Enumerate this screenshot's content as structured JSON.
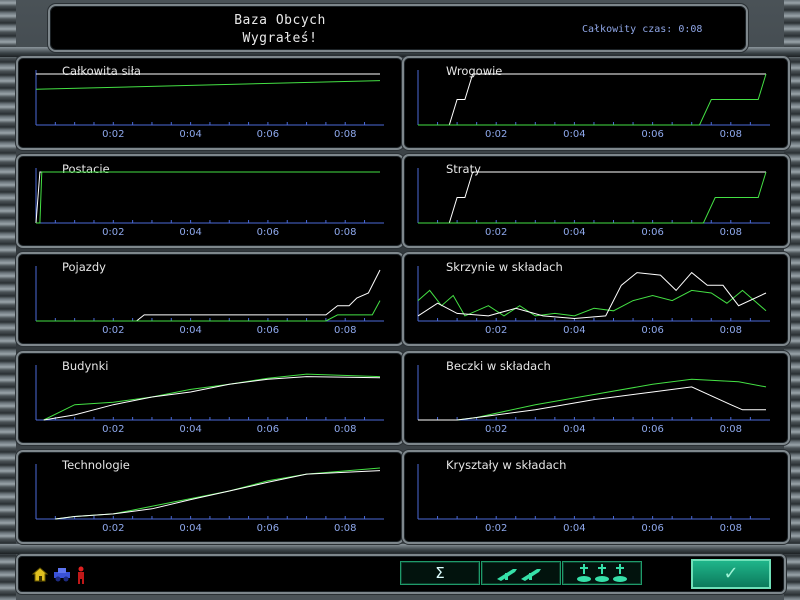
{
  "header": {
    "title_line1": "Baza Obcych",
    "title_line2": "Wygrałeś!",
    "timer_label": "Całkowity czas: 0:08"
  },
  "colors": {
    "green": "#44e044",
    "white": "#ffffff",
    "axis": "#4b6ad8",
    "tick_label": "#8ea8ec",
    "panel_border": "#7e878c",
    "accent_teal": "#1fb58a"
  },
  "x_tick_labels": [
    "0:02",
    "0:04",
    "0:06",
    "0:08"
  ],
  "charts": [
    {
      "title": "Całkowita siła",
      "chart_data": {
        "type": "line",
        "x": [
          0,
          8.9
        ],
        "ylim": [
          0,
          1
        ],
        "series": [
          {
            "color": "green",
            "points": [
              [
                0,
                0.7
              ],
              [
                8.9,
                0.87
              ]
            ]
          },
          {
            "color": "white",
            "points": [
              [
                0,
                1.0
              ],
              [
                8.9,
                1.0
              ]
            ]
          }
        ]
      }
    },
    {
      "title": "Wrogowie",
      "chart_data": {
        "type": "line",
        "x": [
          0,
          8.9
        ],
        "ylim": [
          0,
          1
        ],
        "series": [
          {
            "color": "white",
            "points": [
              [
                0,
                0
              ],
              [
                0.8,
                0
              ],
              [
                1.0,
                0.5
              ],
              [
                1.2,
                0.5
              ],
              [
                1.4,
                1
              ],
              [
                8.9,
                1
              ]
            ]
          },
          {
            "color": "green",
            "points": [
              [
                0,
                0
              ],
              [
                7.2,
                0
              ],
              [
                7.5,
                0.5
              ],
              [
                8.7,
                0.5
              ],
              [
                8.9,
                1
              ]
            ]
          }
        ]
      }
    },
    {
      "title": "Postacie",
      "chart_data": {
        "type": "line",
        "x": [
          0,
          8.9
        ],
        "ylim": [
          0,
          1
        ],
        "series": [
          {
            "color": "white",
            "points": [
              [
                0,
                0
              ],
              [
                0.1,
                1
              ],
              [
                8.9,
                1
              ]
            ]
          },
          {
            "color": "green",
            "points": [
              [
                0,
                0
              ],
              [
                0.1,
                0
              ],
              [
                0.15,
                1
              ],
              [
                8.9,
                1
              ]
            ]
          }
        ]
      }
    },
    {
      "title": "Straty",
      "chart_data": {
        "type": "line",
        "x": [
          0,
          8.9
        ],
        "ylim": [
          0,
          1
        ],
        "series": [
          {
            "color": "white",
            "points": [
              [
                0,
                0
              ],
              [
                0.8,
                0
              ],
              [
                1.0,
                0.5
              ],
              [
                1.2,
                0.5
              ],
              [
                1.4,
                1
              ],
              [
                8.9,
                1
              ]
            ]
          },
          {
            "color": "green",
            "points": [
              [
                0,
                0
              ],
              [
                7.3,
                0
              ],
              [
                7.6,
                0.5
              ],
              [
                8.7,
                0.5
              ],
              [
                8.9,
                1
              ]
            ]
          }
        ]
      }
    },
    {
      "title": "Pojazdy",
      "chart_data": {
        "type": "line",
        "x": [
          0,
          8.9
        ],
        "ylim": [
          0,
          1
        ],
        "series": [
          {
            "color": "white",
            "points": [
              [
                0,
                0
              ],
              [
                2.6,
                0
              ],
              [
                2.8,
                0.12
              ],
              [
                7.5,
                0.12
              ],
              [
                7.8,
                0.3
              ],
              [
                8.1,
                0.3
              ],
              [
                8.3,
                0.45
              ],
              [
                8.6,
                0.55
              ],
              [
                8.9,
                1
              ]
            ]
          },
          {
            "color": "green",
            "points": [
              [
                0,
                0
              ],
              [
                7.5,
                0
              ],
              [
                7.8,
                0.12
              ],
              [
                8.7,
                0.12
              ],
              [
                8.9,
                0.4
              ]
            ]
          }
        ]
      }
    },
    {
      "title": "Skrzynie w składach",
      "chart_data": {
        "type": "line",
        "x": [
          0,
          8.9
        ],
        "ylim": [
          0,
          1
        ],
        "series": [
          {
            "color": "green",
            "points": [
              [
                0,
                0.4
              ],
              [
                0.3,
                0.6
              ],
              [
                0.6,
                0.3
              ],
              [
                0.9,
                0.5
              ],
              [
                1.2,
                0.1
              ],
              [
                1.8,
                0.3
              ],
              [
                2.2,
                0.1
              ],
              [
                2.6,
                0.3
              ],
              [
                3.0,
                0.1
              ],
              [
                3.5,
                0.15
              ],
              [
                4.0,
                0.1
              ],
              [
                4.5,
                0.25
              ],
              [
                5.0,
                0.2
              ],
              [
                5.5,
                0.4
              ],
              [
                6.0,
                0.5
              ],
              [
                6.5,
                0.4
              ],
              [
                7.0,
                0.6
              ],
              [
                7.5,
                0.55
              ],
              [
                7.9,
                0.35
              ],
              [
                8.3,
                0.6
              ],
              [
                8.9,
                0.2
              ]
            ]
          },
          {
            "color": "white",
            "points": [
              [
                0,
                0.1
              ],
              [
                0.5,
                0.35
              ],
              [
                1.0,
                0.15
              ],
              [
                1.8,
                0.1
              ],
              [
                2.5,
                0.25
              ],
              [
                3.2,
                0.1
              ],
              [
                4.0,
                0.05
              ],
              [
                4.8,
                0.1
              ],
              [
                5.2,
                0.7
              ],
              [
                5.6,
                0.95
              ],
              [
                6.2,
                0.9
              ],
              [
                6.6,
                0.6
              ],
              [
                7.0,
                0.95
              ],
              [
                7.4,
                0.7
              ],
              [
                7.8,
                0.7
              ],
              [
                8.2,
                0.3
              ],
              [
                8.9,
                0.55
              ]
            ]
          }
        ]
      }
    },
    {
      "title": "Budynki",
      "chart_data": {
        "type": "line",
        "x": [
          0,
          8.9
        ],
        "ylim": [
          0,
          1
        ],
        "series": [
          {
            "color": "green",
            "points": [
              [
                0.2,
                0
              ],
              [
                1.0,
                0.3
              ],
              [
                2.0,
                0.35
              ],
              [
                3.0,
                0.45
              ],
              [
                4.0,
                0.6
              ],
              [
                5.0,
                0.7
              ],
              [
                6.0,
                0.82
              ],
              [
                7.0,
                0.9
              ],
              [
                8.9,
                0.85
              ]
            ]
          },
          {
            "color": "white",
            "points": [
              [
                0.2,
                0
              ],
              [
                1.0,
                0.1
              ],
              [
                2.0,
                0.3
              ],
              [
                3.0,
                0.45
              ],
              [
                4.0,
                0.55
              ],
              [
                5.0,
                0.7
              ],
              [
                6.0,
                0.8
              ],
              [
                7.0,
                0.85
              ],
              [
                8.9,
                0.83
              ]
            ]
          }
        ]
      }
    },
    {
      "title": "Beczki w składach",
      "chart_data": {
        "type": "line",
        "x": [
          0,
          8.9
        ],
        "ylim": [
          0,
          1
        ],
        "series": [
          {
            "color": "green",
            "points": [
              [
                0,
                0
              ],
              [
                1.0,
                0
              ],
              [
                1.5,
                0.05
              ],
              [
                3.0,
                0.3
              ],
              [
                4.5,
                0.5
              ],
              [
                6.0,
                0.7
              ],
              [
                7.0,
                0.8
              ],
              [
                8.2,
                0.75
              ],
              [
                8.9,
                0.65
              ]
            ]
          },
          {
            "color": "white",
            "points": [
              [
                0,
                0
              ],
              [
                1.0,
                0
              ],
              [
                1.5,
                0.05
              ],
              [
                3.0,
                0.2
              ],
              [
                4.5,
                0.4
              ],
              [
                6.0,
                0.55
              ],
              [
                7.0,
                0.65
              ],
              [
                8.0,
                0.3
              ],
              [
                8.3,
                0.2
              ],
              [
                8.9,
                0.2
              ]
            ]
          }
        ]
      }
    },
    {
      "title": "Technologie",
      "chart_data": {
        "type": "line",
        "x": [
          0,
          8.9
        ],
        "ylim": [
          0,
          1
        ],
        "series": [
          {
            "color": "green",
            "points": [
              [
                0.5,
                0
              ],
              [
                1.0,
                0.05
              ],
              [
                2.0,
                0.1
              ],
              [
                3.0,
                0.25
              ],
              [
                4.0,
                0.4
              ],
              [
                5.0,
                0.55
              ],
              [
                6.0,
                0.75
              ],
              [
                7.0,
                0.88
              ],
              [
                8.9,
                1
              ]
            ]
          },
          {
            "color": "white",
            "points": [
              [
                0.5,
                0
              ],
              [
                1.0,
                0.05
              ],
              [
                2.0,
                0.1
              ],
              [
                3.0,
                0.2
              ],
              [
                4.0,
                0.38
              ],
              [
                5.0,
                0.55
              ],
              [
                6.0,
                0.72
              ],
              [
                7.0,
                0.88
              ],
              [
                8.9,
                0.95
              ]
            ]
          }
        ]
      }
    },
    {
      "title": "Kryształy w składach",
      "chart_data": {
        "type": "line",
        "x": [
          0,
          8.9
        ],
        "ylim": [
          0,
          1
        ],
        "series": []
      }
    }
  ],
  "bottom": {
    "status_icons": [
      "house-icon",
      "vehicle-icon",
      "soldier-icon"
    ],
    "buttons": [
      {
        "label": "Σ",
        "icon": "sigma-icon"
      },
      {
        "label": "",
        "icon": "weapons-icon"
      },
      {
        "label": "",
        "icon": "graves-icon"
      }
    ],
    "ok_label": "✓"
  }
}
